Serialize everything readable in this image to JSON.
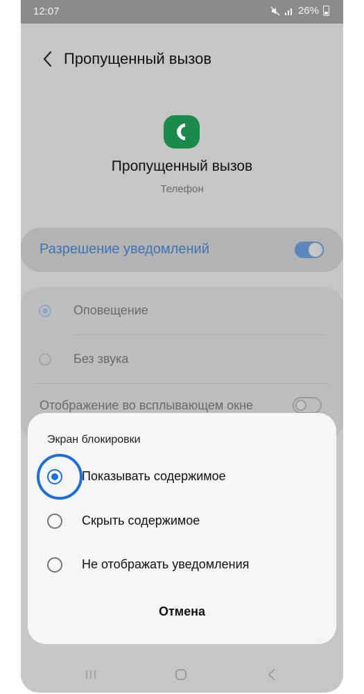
{
  "status": {
    "time": "12:07",
    "battery": "26%",
    "icons": [
      "mute-icon",
      "signal-icon",
      "battery-icon"
    ]
  },
  "header": {
    "title": "Пропущенный вызов",
    "back_icon": "chevron-left-icon"
  },
  "app": {
    "name": "Пропущенный вызов",
    "subtitle": "Телефон",
    "icon": "phone-app-icon",
    "icon_color": "#1a8a4a"
  },
  "permission": {
    "label": "Разрешение уведомлений",
    "enabled": true
  },
  "alert_options": [
    {
      "label": "Оповещение",
      "selected": true
    },
    {
      "label": "Без звука",
      "selected": false
    }
  ],
  "popup": {
    "label": "Отображение во всплывающем окне",
    "enabled": false
  },
  "dialog": {
    "title": "Экран блокировки",
    "options": [
      {
        "label": "Показывать содержимое",
        "selected": true
      },
      {
        "label": "Скрыть содержимое",
        "selected": false
      },
      {
        "label": "Не отображать уведомления",
        "selected": false
      }
    ],
    "cancel_label": "Отмена"
  },
  "colors": {
    "accent": "#1a6ee0",
    "scrim": "#c6c6c6",
    "permission_text": "#3d74b4"
  },
  "navbar": {
    "icons": [
      "recent-apps-icon",
      "home-icon",
      "back-icon"
    ]
  }
}
